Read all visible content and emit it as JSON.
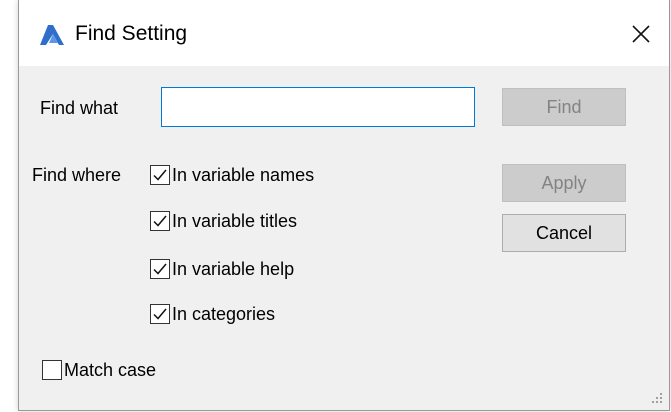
{
  "window": {
    "title": "Find Setting"
  },
  "find_what": {
    "label": "Find what",
    "value": "",
    "placeholder": ""
  },
  "find_where": {
    "label": "Find where",
    "options": [
      {
        "label": "In variable names",
        "checked": true
      },
      {
        "label": "In variable titles",
        "checked": true
      },
      {
        "label": "In variable help",
        "checked": true
      },
      {
        "label": "In categories",
        "checked": true
      }
    ]
  },
  "match_case": {
    "label": "Match case",
    "checked": false
  },
  "buttons": {
    "find": "Find",
    "apply": "Apply",
    "cancel": "Cancel"
  },
  "icons": {
    "app": "bricscad-logo-icon",
    "close": "close-icon",
    "check": "checkmark-icon",
    "grip": "resize-grip-icon"
  },
  "colors": {
    "accent": "#0078d7",
    "app_icon": "#2f6fcb",
    "dialog_bg": "#f0f0f0"
  }
}
